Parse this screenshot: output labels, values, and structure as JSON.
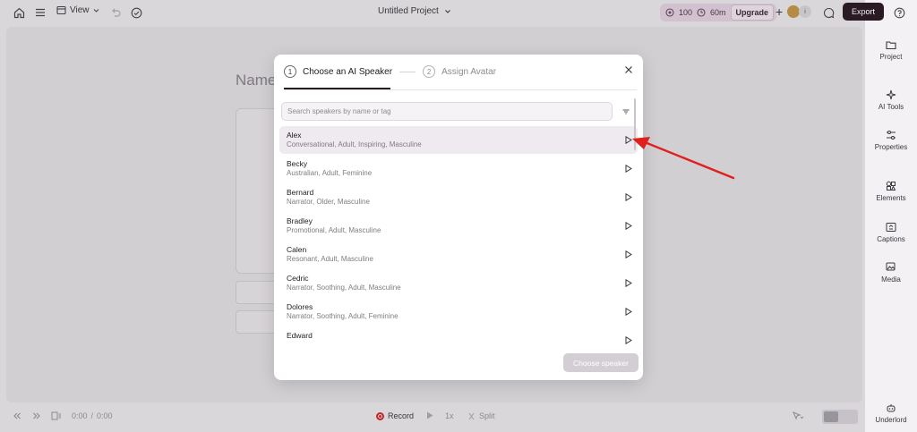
{
  "topbar": {
    "view_label": "View",
    "project_title": "Untitled Project",
    "credits_value": "100",
    "minutes_value": "60m",
    "upgrade_label": "Upgrade",
    "avatar_badge": "i",
    "export_label": "Export"
  },
  "background": {
    "name_heading": "Name"
  },
  "sidebar": {
    "items": [
      {
        "label": "Project",
        "icon": "folder-icon"
      },
      {
        "label": "AI Tools",
        "icon": "sparkle-icon"
      },
      {
        "label": "Properties",
        "icon": "sliders-icon"
      },
      {
        "label": "Elements",
        "icon": "shapes-icon"
      },
      {
        "label": "Captions",
        "icon": "captions-icon"
      },
      {
        "label": "Media",
        "icon": "media-icon"
      },
      {
        "label": "Underlord",
        "icon": "robot-icon"
      }
    ]
  },
  "bottombar": {
    "time_current": "0:00",
    "time_separator": "/",
    "time_total": "0:00",
    "record_label": "Record",
    "speed_label": "1x",
    "split_label": "Split"
  },
  "modal": {
    "steps": [
      {
        "number": "1",
        "label": "Choose an AI Speaker",
        "active": true
      },
      {
        "number": "2",
        "label": "Assign Avatar",
        "active": false
      }
    ],
    "search_placeholder": "Search speakers by name or tag",
    "speakers": [
      {
        "name": "Alex",
        "tags": "Conversational, Adult, Inspiring, Masculine",
        "selected": true
      },
      {
        "name": "Becky",
        "tags": "Australian, Adult, Feminine",
        "selected": false
      },
      {
        "name": "Bernard",
        "tags": "Narrator, Older, Masculine",
        "selected": false
      },
      {
        "name": "Bradley",
        "tags": "Promotional, Adult, Masculine",
        "selected": false
      },
      {
        "name": "Calen",
        "tags": "Resonant, Adult, Masculine",
        "selected": false
      },
      {
        "name": "Cedric",
        "tags": "Narrator, Soothing, Adult, Masculine",
        "selected": false
      },
      {
        "name": "Dolores",
        "tags": "Narrator, Soothing, Adult, Feminine",
        "selected": false
      },
      {
        "name": "Edward",
        "tags": "",
        "selected": false
      }
    ],
    "choose_button_label": "Choose speaker"
  },
  "colors": {
    "accent_dark": "#2a1a24",
    "selected_row": "#efeaef",
    "annotation_arrow": "#e0201c",
    "record_red": "#d52b2b"
  }
}
